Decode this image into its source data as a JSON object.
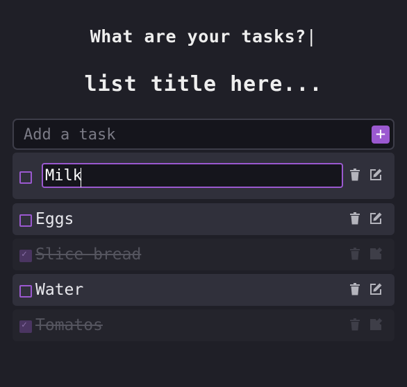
{
  "header": {
    "title": "What are your tasks?",
    "caret": "|",
    "list_title": "list title here..."
  },
  "add_task": {
    "placeholder": "Add a task",
    "button_label": "+"
  },
  "tasks": [
    {
      "text": "Milk",
      "done": false,
      "editing": true
    },
    {
      "text": "Eggs",
      "done": false,
      "editing": false
    },
    {
      "text": "Slice bread",
      "done": true,
      "editing": false
    },
    {
      "text": "Water",
      "done": false,
      "editing": false
    },
    {
      "text": "Tomatos",
      "done": true,
      "editing": false
    }
  ],
  "icons": {
    "delete": "trash-icon",
    "edit": "edit-icon",
    "check": "checkmark-icon"
  },
  "colors": {
    "background": "#1f1f27",
    "accent": "#9b59d0",
    "row": "#30303b",
    "row_done": "#24242c"
  }
}
